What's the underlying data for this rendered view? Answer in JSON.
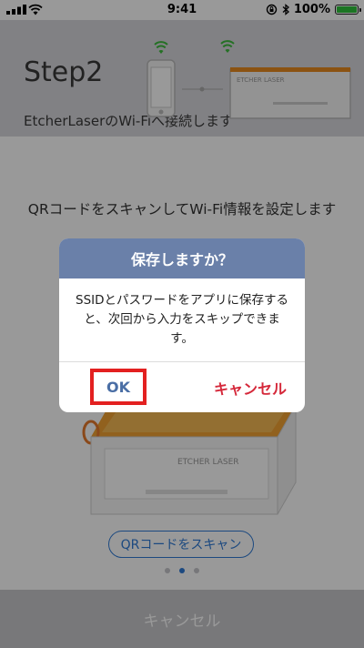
{
  "status_bar": {
    "time": "9:41",
    "battery_percent": "100%"
  },
  "header": {
    "step": "Step2",
    "subtitle": "EtcherLaserのWi-Fiへ接続します",
    "device_brand": "ETCHER LASER"
  },
  "content": {
    "instruction": "QRコードをスキャンしてWi-Fi情報を設定します",
    "machine_brand": "ETCHER LASER",
    "qr_button_label": "QRコードをスキャン",
    "page_dots": {
      "count": 3,
      "active_index": 1
    }
  },
  "bottom_bar": {
    "cancel_label": "キャンセル"
  },
  "alert": {
    "title": "保存しますか？",
    "message": "SSIDとパスワードをアプリに保存すると、次回から入力をスキップできます。",
    "ok_label": "OK",
    "cancel_label": "キャンセル"
  },
  "colors": {
    "accent": "#2f7bd6",
    "alert_title_bg": "#6a80a9",
    "destructive": "#d5283a",
    "highlight_box": "#e32020",
    "battery": "#2fc43b"
  }
}
